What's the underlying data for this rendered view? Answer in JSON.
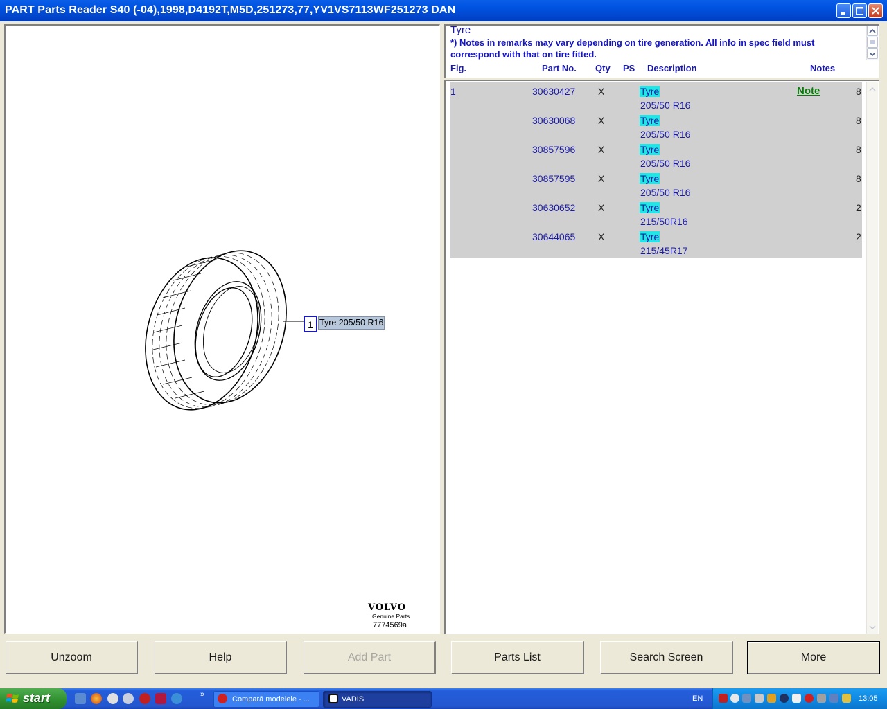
{
  "window": {
    "title": "PART Parts Reader S40 (-04),1998,D4192T,M5D,251273,77,YV1VS7113WF251273 DAN"
  },
  "drawing": {
    "callout_number": "1",
    "callout_label": "Tyre 205/50 R16",
    "brand": "VOLVO",
    "brand_sub": "Genuine Parts",
    "drawing_id": "7774569a"
  },
  "header": {
    "title": "Tyre",
    "note": "*) Notes in remarks may vary depending on tire generation. All info in spec field must correspond with that on tire fitted.",
    "columns": {
      "fig": "Fig.",
      "part_no": "Part No.",
      "qty": "Qty",
      "ps": "PS",
      "description": "Description",
      "notes": "Notes"
    }
  },
  "parts": [
    {
      "fig": "1",
      "part_no": "30630427",
      "qty": "X",
      "desc": "Tyre",
      "spec": "205/50 R16",
      "note": "Note",
      "count": "8"
    },
    {
      "fig": "",
      "part_no": "30630068",
      "qty": "X",
      "desc": "Tyre",
      "spec": "205/50 R16",
      "note": "",
      "count": "8"
    },
    {
      "fig": "",
      "part_no": "30857596",
      "qty": "X",
      "desc": "Tyre",
      "spec": "205/50 R16",
      "note": "",
      "count": "8"
    },
    {
      "fig": "",
      "part_no": "30857595",
      "qty": "X",
      "desc": "Tyre",
      "spec": "205/50 R16",
      "note": "",
      "count": "8"
    },
    {
      "fig": "",
      "part_no": "30630652",
      "qty": "X",
      "desc": "Tyre",
      "spec": "215/50R16",
      "note": "",
      "count": "2"
    },
    {
      "fig": "",
      "part_no": "30644065",
      "qty": "X",
      "desc": "Tyre",
      "spec": "215/45R17",
      "note": "",
      "count": "2"
    }
  ],
  "buttons": {
    "unzoom": "Unzoom",
    "help": "Help",
    "add_part": "Add Part",
    "parts_list": "Parts List",
    "search_screen": "Search Screen",
    "more": "More"
  },
  "taskbar": {
    "start": "start",
    "tasks": [
      {
        "label": "Comparā modelele - ...",
        "icon": "opera-icon"
      },
      {
        "label": "VADIS",
        "icon": "vadis-icon"
      }
    ],
    "language": "EN",
    "clock": "13:05"
  }
}
